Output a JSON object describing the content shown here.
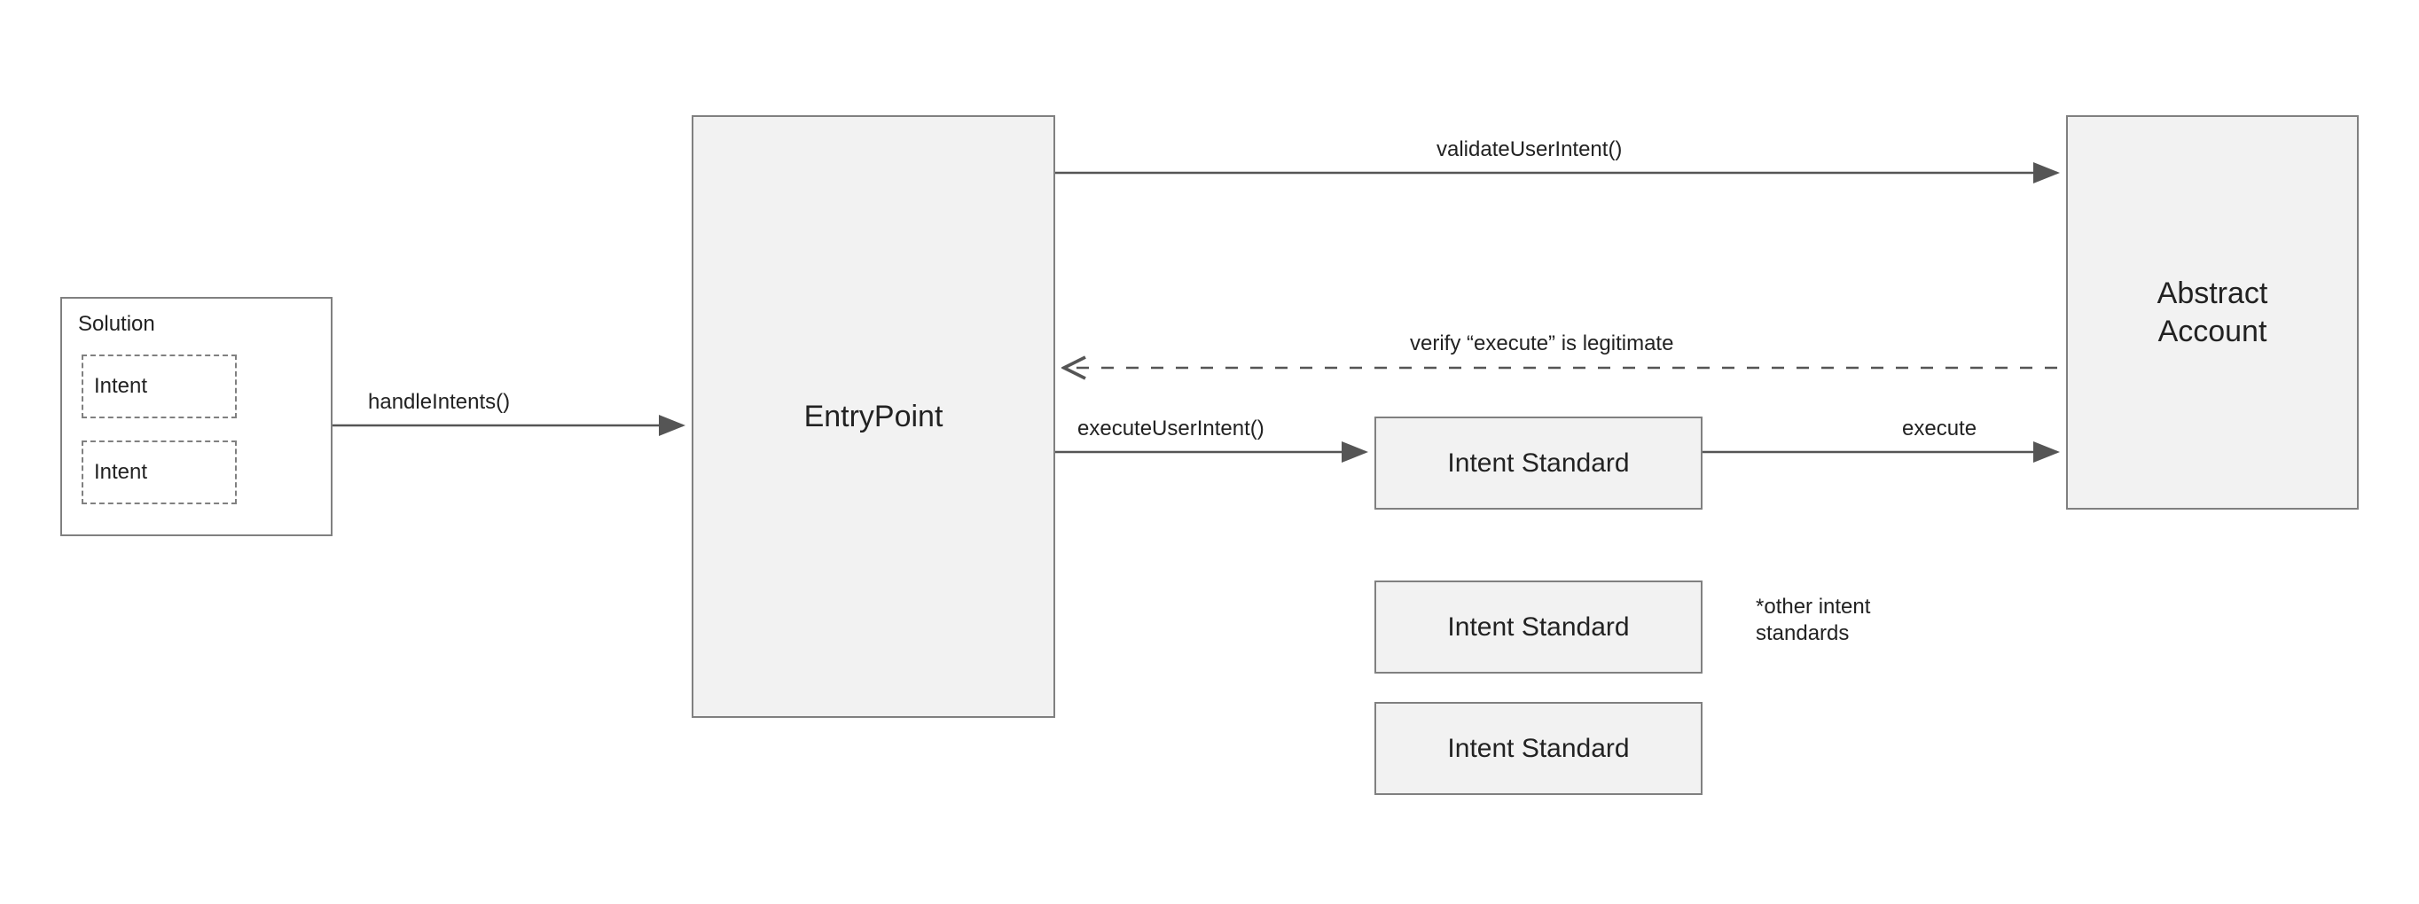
{
  "boxes": {
    "solution": {
      "title": "Solution",
      "intent1": "Intent",
      "intent2": "Intent"
    },
    "entrypoint": "EntryPoint",
    "intent_standard_1": "Intent Standard",
    "intent_standard_2": "Intent Standard",
    "intent_standard_3": "Intent Standard",
    "abstract_account": "Abstract\nAccount"
  },
  "edges": {
    "handle_intents": "handleIntents()",
    "validate_user_intent": "validateUserIntent()",
    "execute_user_intent": "executeUserIntent()",
    "execute": "execute",
    "verify_execute": "verify “execute” is legitimate"
  },
  "notes": {
    "other_intent_standards": "*other intent\nstandards"
  }
}
